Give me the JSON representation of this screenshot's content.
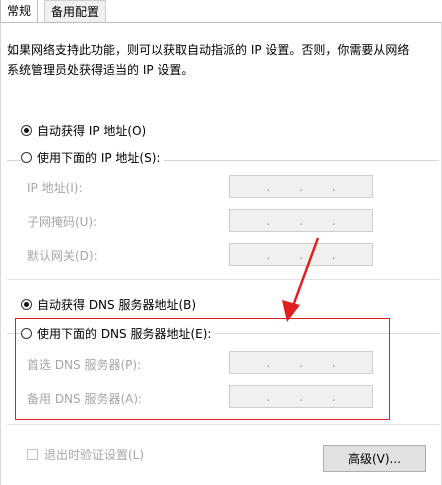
{
  "tabs": [
    {
      "label": "常规",
      "active": true
    },
    {
      "label": "备用配置",
      "active": false
    }
  ],
  "description": "如果网络支持此功能，则可以获取自动指派的 IP 设置。否则，你需要从网络系统管理员处获得适当的 IP 设置。",
  "ip_section": {
    "auto_label": "自动获得 IP 地址(O)",
    "auto_selected": true,
    "manual_label": "使用下面的 IP 地址(S):",
    "manual_selected": false,
    "fields": [
      {
        "label": "IP 地址(I):",
        "dots": [
          ".",
          ".",
          "."
        ]
      },
      {
        "label": "子网掩码(U):",
        "dots": [
          ".",
          ".",
          "."
        ]
      },
      {
        "label": "默认网关(D):",
        "dots": [
          ".",
          ".",
          "."
        ]
      }
    ]
  },
  "dns_section": {
    "auto_label": "自动获得 DNS 服务器地址(B)",
    "auto_selected": true,
    "manual_label": "使用下面的 DNS 服务器地址(E):",
    "manual_selected": false,
    "fields": [
      {
        "label": "首选 DNS 服务器(P):",
        "dots": [
          ".",
          ".",
          "."
        ]
      },
      {
        "label": "备用 DNS 服务器(A):",
        "dots": [
          ".",
          ".",
          "."
        ]
      }
    ]
  },
  "validate_label": "退出时验证设置(L)",
  "validate_checked": false,
  "advanced_button": "高级(V)...",
  "colors": {
    "annotation": "#e02020"
  }
}
